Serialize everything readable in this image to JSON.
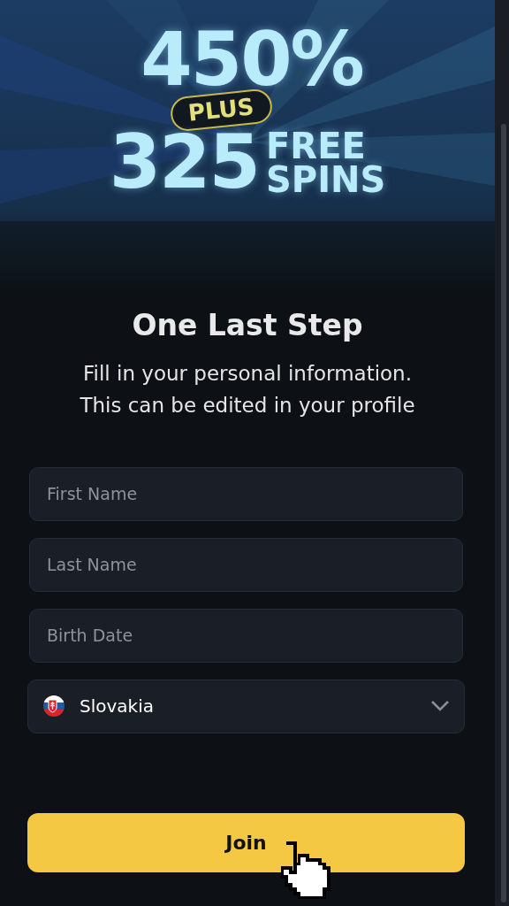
{
  "banner": {
    "headline": "450%",
    "badge": "PLUS",
    "spins": "325",
    "spins_label": [
      "FREE",
      "SPINS"
    ]
  },
  "title": "One Last Step",
  "subtitle": [
    "Fill in your personal information.",
    "This can be edited in your profile"
  ],
  "fields": [
    {
      "placeholder": "First Name"
    },
    {
      "placeholder": "Last Name"
    },
    {
      "placeholder": "Birth Date"
    }
  ],
  "country": {
    "value": "Slovakia"
  },
  "submit": {
    "label": "Join"
  }
}
